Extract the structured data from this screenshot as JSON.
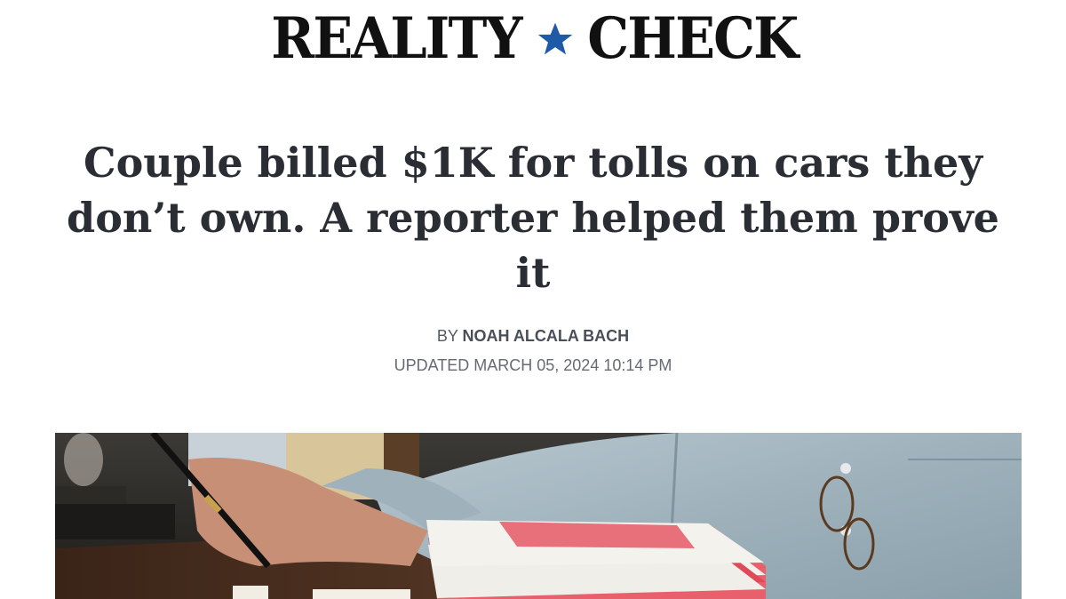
{
  "masthead": {
    "left_word": "REALITY",
    "right_word": "CHECK",
    "star_icon": "star-icon",
    "colors": {
      "text": "#111111",
      "star": "#1f5aa6"
    }
  },
  "article": {
    "headline": "Couple billed $1K for tolls on cars they don’t own. A reporter helped them prove it",
    "byline_prefix": "BY",
    "author": "NOAH ALCALA BACH",
    "updated": "UPDATED MARCH 05, 2024 10:14 PM"
  },
  "hero_image": {
    "subject": "photo-person-in-denim-shirt-with-stack-of-red-toll-bills"
  }
}
